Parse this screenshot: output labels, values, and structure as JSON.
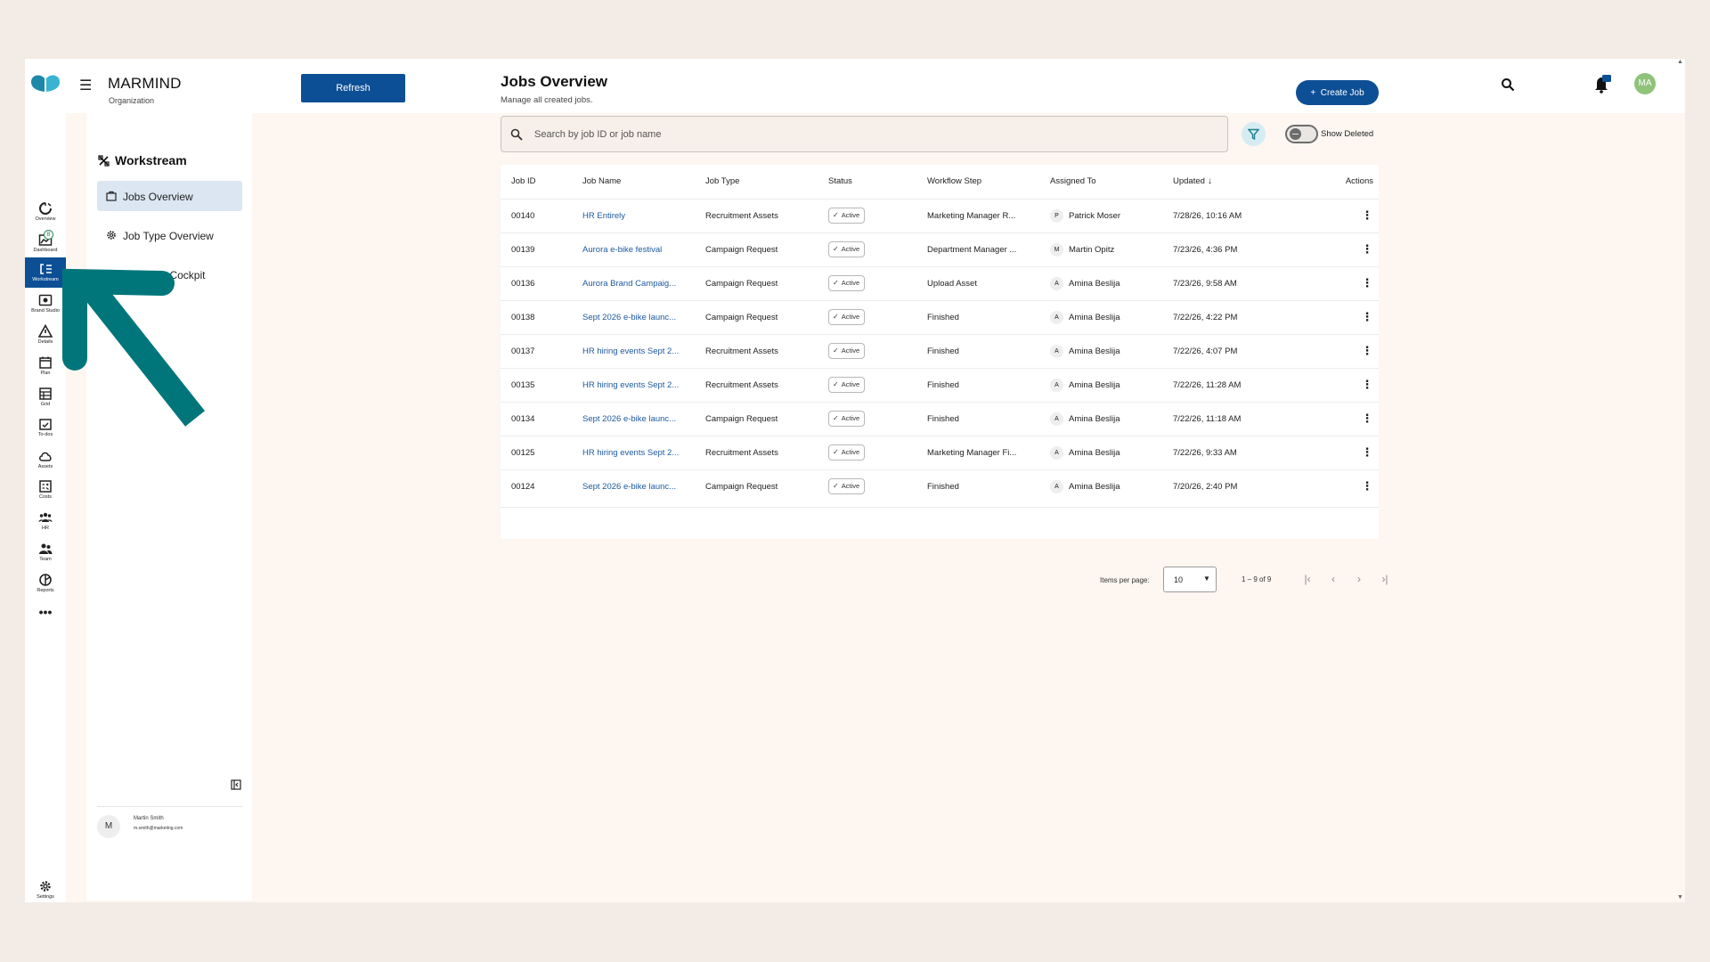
{
  "app": {
    "name": "MARMIND",
    "org": "Organization",
    "refresh_label": "Refresh",
    "avatar_initials": "MA",
    "brand_color": "#0d4f95"
  },
  "rail": {
    "items": [
      {
        "label": "Overview",
        "icon": "overview-icon"
      },
      {
        "label": "Dashboard",
        "icon": "dashboard-icon",
        "badge": "8"
      },
      {
        "label": "Workstream",
        "icon": "workstream-icon",
        "active": true
      },
      {
        "label": "Brand Studio",
        "icon": "brand-studio-icon"
      },
      {
        "label": "Details",
        "icon": "details-icon"
      },
      {
        "label": "Plan",
        "icon": "plan-icon"
      },
      {
        "label": "Grid",
        "icon": "grid-icon"
      },
      {
        "label": "To-dos",
        "icon": "todos-icon"
      },
      {
        "label": "Assets",
        "icon": "assets-icon"
      },
      {
        "label": "Costs",
        "icon": "costs-icon"
      },
      {
        "label": "HR",
        "icon": "hr-icon"
      },
      {
        "label": "Team",
        "icon": "team-icon"
      },
      {
        "label": "Reports",
        "icon": "reports-icon"
      }
    ],
    "more": "•••",
    "settings_label": "Settings"
  },
  "sidebar": {
    "title": "Workstream",
    "items": [
      {
        "label": "Jobs Overview",
        "active": true
      },
      {
        "label": "Job Type Overview"
      },
      {
        "label": "Workflow Cockpit"
      }
    ],
    "user": {
      "initial": "M",
      "name": "Martin Smith",
      "email": "m.smith@marketing.com"
    }
  },
  "main": {
    "title": "Jobs Overview",
    "subtitle": "Manage all created jobs.",
    "create_label": "Create Job",
    "search_placeholder": "Search by job ID or job name",
    "show_deleted_label": "Show Deleted",
    "columns": [
      "Job ID",
      "Job Name",
      "Job Type",
      "Status",
      "Workflow Step",
      "Assigned To",
      "Updated",
      "Actions"
    ],
    "rows": [
      {
        "id": "00140",
        "name": "HR Entirely",
        "type": "Recruitment Assets",
        "status": "Active",
        "step": "Marketing Manager R...",
        "avatar": "P",
        "assignee": "Patrick Moser",
        "updated": "7/28/26, 10:16 AM"
      },
      {
        "id": "00139",
        "name": "Aurora e-bike festival",
        "type": "Campaign Request",
        "status": "Active",
        "step": "Department Manager ...",
        "avatar": "M",
        "assignee": "Martin Opitz",
        "updated": "7/23/26, 4:36 PM"
      },
      {
        "id": "00136",
        "name": "Aurora Brand Campaig...",
        "type": "Campaign Request",
        "status": "Active",
        "step": "Upload Asset",
        "avatar": "A",
        "assignee": "Amina Beslija",
        "updated": "7/23/26, 9:58 AM"
      },
      {
        "id": "00138",
        "name": "Sept 2026 e-bike launc...",
        "type": "Campaign Request",
        "status": "Active",
        "step": "Finished",
        "avatar": "A",
        "assignee": "Amina Beslija",
        "updated": "7/22/26, 4:22 PM"
      },
      {
        "id": "00137",
        "name": "HR hiring events Sept 2...",
        "type": "Recruitment Assets",
        "status": "Active",
        "step": "Finished",
        "avatar": "A",
        "assignee": "Amina Beslija",
        "updated": "7/22/26, 4:07 PM"
      },
      {
        "id": "00135",
        "name": "HR hiring events Sept 2...",
        "type": "Recruitment Assets",
        "status": "Active",
        "step": "Finished",
        "avatar": "A",
        "assignee": "Amina Beslija",
        "updated": "7/22/26, 11:28 AM"
      },
      {
        "id": "00134",
        "name": "Sept 2026 e-bike launc...",
        "type": "Campaign Request",
        "status": "Active",
        "step": "Finished",
        "avatar": "A",
        "assignee": "Amina Beslija",
        "updated": "7/22/26, 11:18 AM"
      },
      {
        "id": "00125",
        "name": "HR hiring events Sept 2...",
        "type": "Recruitment Assets",
        "status": "Active",
        "step": "Marketing Manager Fi...",
        "avatar": "A",
        "assignee": "Amina Beslija",
        "updated": "7/22/26, 9:33 AM"
      },
      {
        "id": "00124",
        "name": "Sept 2026 e-bike launc...",
        "type": "Campaign Request",
        "status": "Active",
        "step": "Finished",
        "avatar": "A",
        "assignee": "Amina Beslija",
        "updated": "7/20/26, 2:40 PM"
      }
    ],
    "pagination": {
      "items_per_page_label": "Items per page:",
      "items_per_page": "10",
      "range": "1 – 9 of 9"
    }
  },
  "annotation": {
    "color": "#00767a"
  }
}
